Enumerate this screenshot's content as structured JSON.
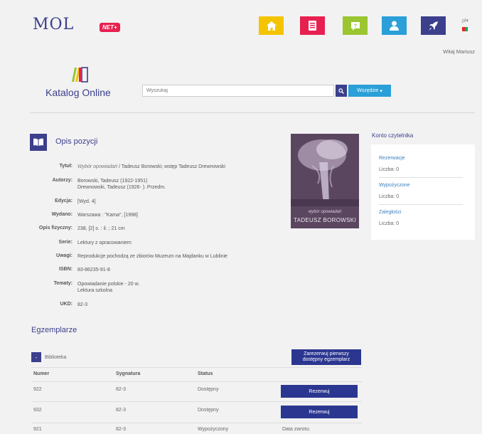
{
  "header": {
    "logo_text": "MOL",
    "logo_badge": "NET+",
    "nav_icons": [
      "home-icon",
      "list-icon",
      "help-icon",
      "user-icon",
      "rocket-icon"
    ],
    "nav_colors": [
      "#f5c400",
      "#e8204f",
      "#9bc531",
      "#2a9fd8",
      "#3b3f8c"
    ],
    "lang": "pl"
  },
  "welcome": "Witaj Mariusz",
  "catalog": {
    "title": "Katalog Online",
    "search_placeholder": "Wyszukaj",
    "scope_button": "Wszędzie"
  },
  "record": {
    "section_title": "Opis pozycji",
    "fields": [
      {
        "label": "Tytuł:",
        "value_italic": "Wybór opowiadań",
        "value": " / Tadeusz Borowski; wstęp Tadeusz Drewnowski"
      },
      {
        "label": "Autorzy:",
        "value": "Borowski, Tadeusz (1922-1951)",
        "value2": "Drewnowski, Tadeusz (1926- ). Przedm."
      },
      {
        "label": "Edycja:",
        "value": "[Wyd. 4]"
      },
      {
        "label": "Wydano:",
        "value": "Warszawa : \"Kama\", [1998]"
      },
      {
        "label": "Opis fizyczny:",
        "value": "238, [2] s. : il. ; 21 cm"
      },
      {
        "label": "Serie:",
        "value": "Lektury z opracowaniem"
      },
      {
        "label": "Uwagi:",
        "value": "Reprodukcje pochodzą ze zbiorów Muzeum na Majdanku w Lublinie"
      },
      {
        "label": "ISBN:",
        "value": "83-86235-91-8"
      },
      {
        "label": "Tematy:",
        "value": "Opowiadanie polskie - 20 w.",
        "value2": "Lektura szkolna"
      },
      {
        "label": "UKD:",
        "value": "82-3"
      }
    ],
    "cover": {
      "subtitle": "wybór opowiadań",
      "author": "TADEUSZ BOROWSKI"
    }
  },
  "account": {
    "title": "Konto czytelnika",
    "items": [
      {
        "label": "Rezerwacje",
        "count": "Liczba: 0"
      },
      {
        "label": "Wypożyczone",
        "count": "Liczba: 0"
      },
      {
        "label": "Zaległości",
        "count": "Liczba: 0"
      }
    ]
  },
  "copies": {
    "title": "Egzemplarze",
    "library_label": "Biblioteka",
    "collapse_symbol": "-",
    "reserve_first_line1": "Zarezerwuj pierwszy",
    "reserve_first_line2": "dostępny egzemplarz",
    "columns": [
      "Numer",
      "Sygnatura",
      "Status"
    ],
    "rows": [
      {
        "number": "922",
        "signature": "82-3",
        "status": "Dostępny",
        "action": "Rezerwuj"
      },
      {
        "number": "932",
        "signature": "82-3",
        "status": "Dostępny",
        "action": "Rezerwuj"
      },
      {
        "number": "921",
        "signature": "82-3",
        "status": "Wypożyczony",
        "action": "Data zwrotu:"
      }
    ]
  }
}
